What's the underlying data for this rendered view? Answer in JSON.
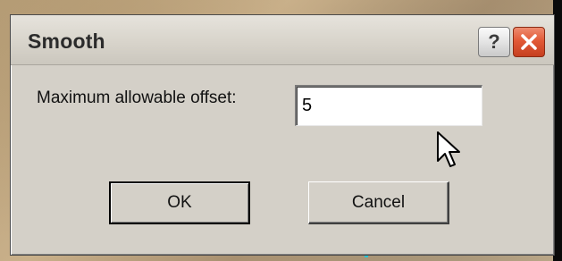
{
  "dialog": {
    "title": "Smooth",
    "help_button": "?",
    "close_icon": "close-x-icon"
  },
  "form": {
    "offset_label": "Maximum allowable offset:",
    "offset_value": "5"
  },
  "buttons": {
    "ok_label": "OK",
    "cancel_label": "Cancel"
  },
  "colors": {
    "dialog_face": "#d4d0c8",
    "close_button": "#e25a36",
    "title_text": "#2b2b2b"
  }
}
